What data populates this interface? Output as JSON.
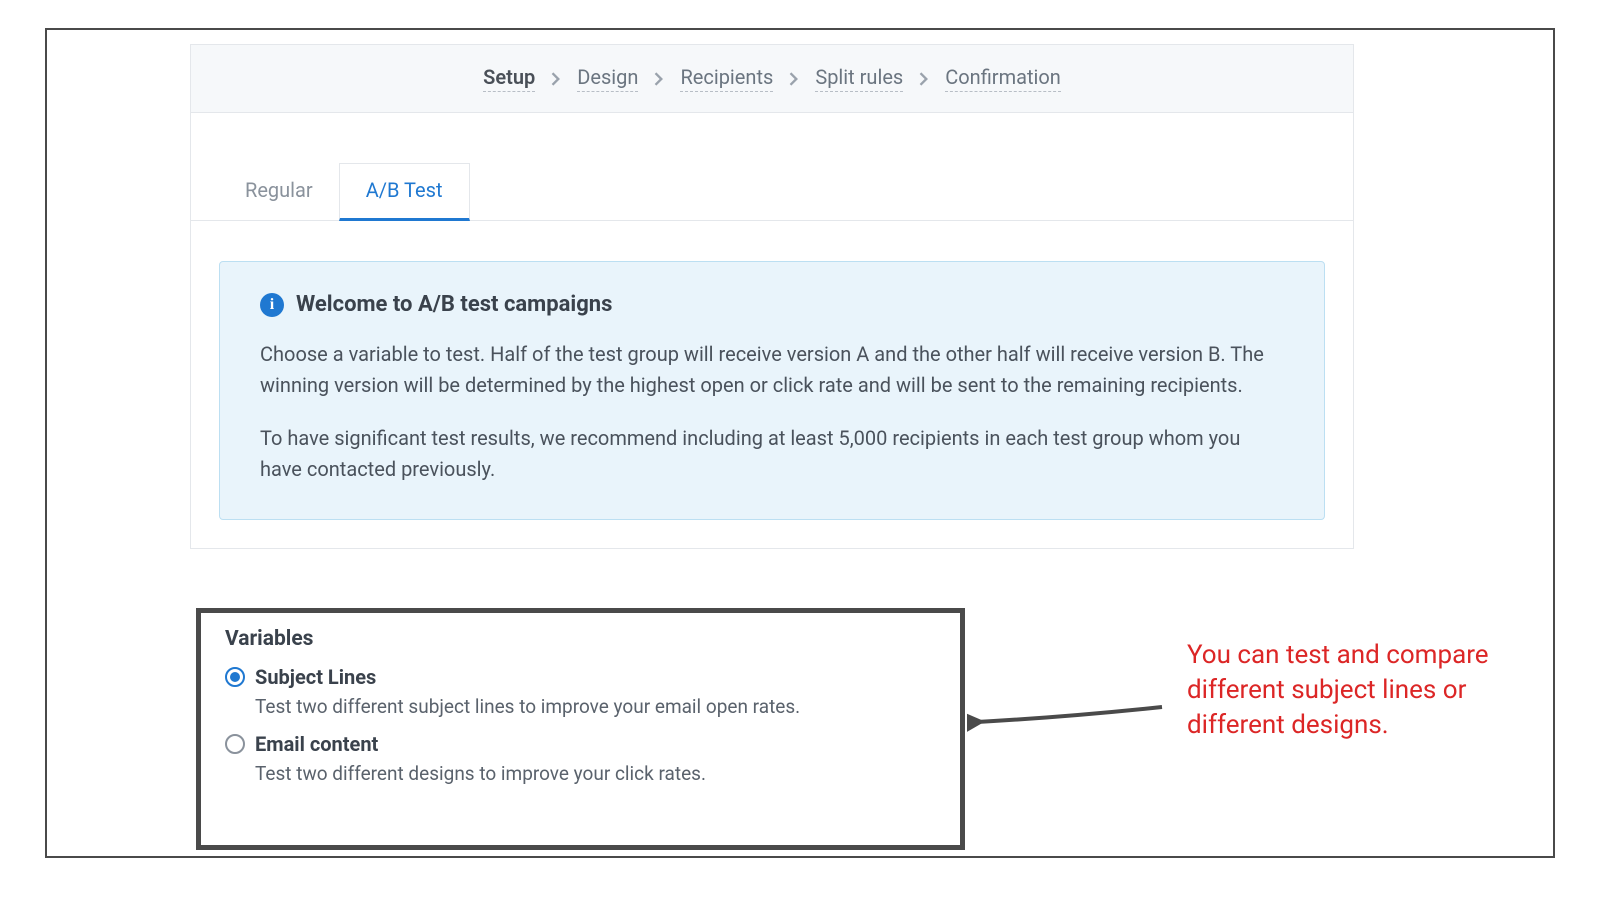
{
  "steps": [
    {
      "label": "Setup",
      "active": true
    },
    {
      "label": "Design",
      "active": false
    },
    {
      "label": "Recipients",
      "active": false
    },
    {
      "label": "Split rules",
      "active": false
    },
    {
      "label": "Confirmation",
      "active": false
    }
  ],
  "tabs": [
    {
      "label": "Regular",
      "active": false
    },
    {
      "label": "A/B Test",
      "active": true
    }
  ],
  "callout": {
    "title": "Welcome to A/B test campaigns",
    "p1": "Choose a variable to test. Half of the test group will receive version A and the other half will receive version B. The winning version will be determined by the highest open or click rate and will be sent to the remaining recipients.",
    "p2": "To have significant test results, we recommend including at least 5,000 recipients in each test group whom you have contacted previously."
  },
  "variables": {
    "heading": "Variables",
    "options": [
      {
        "label": "Subject Lines",
        "desc": "Test two different subject lines to improve your email open rates.",
        "selected": true
      },
      {
        "label": "Email content",
        "desc": "Test two different designs to improve your click rates.",
        "selected": false
      }
    ]
  },
  "annotation": {
    "text": "You can test and compare different subject lines or different designs."
  }
}
